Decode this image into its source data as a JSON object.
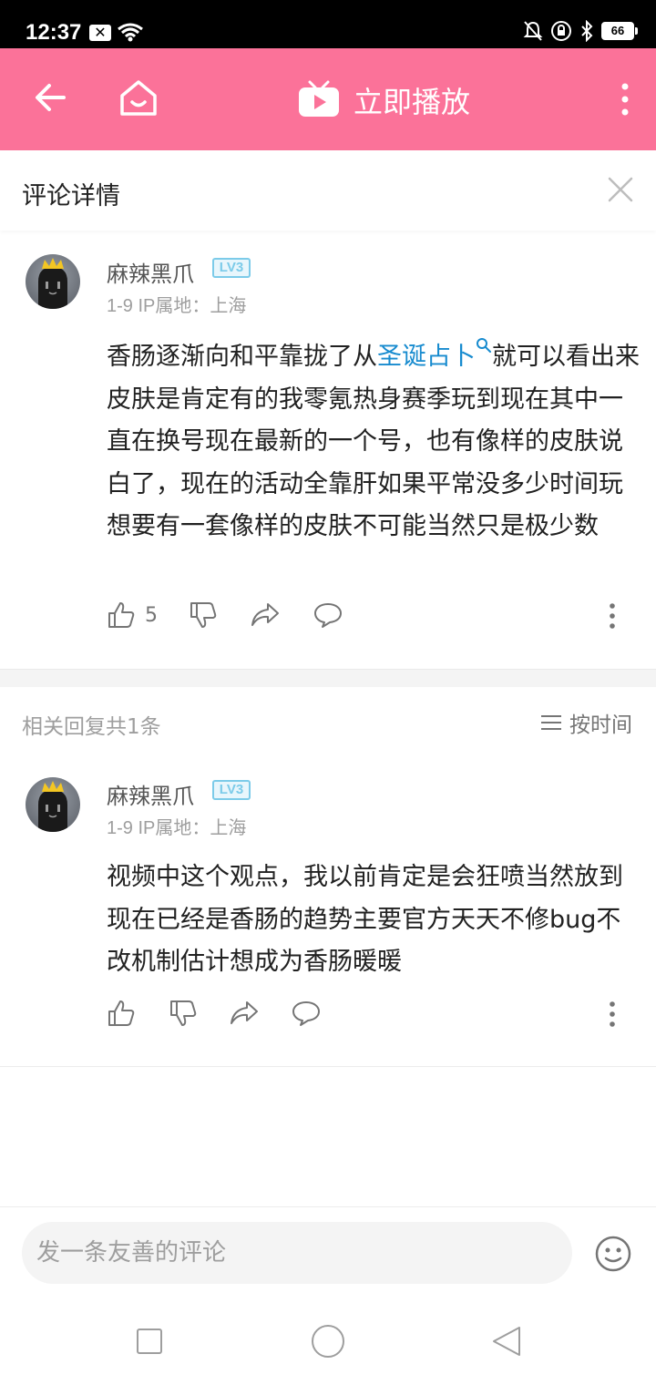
{
  "status_bar": {
    "time": "12:37",
    "battery": "66",
    "icons": [
      "notification-x-icon",
      "wifi-icon",
      "mute-bell-icon",
      "rotation-lock-icon",
      "bluetooth-icon",
      "battery-icon"
    ]
  },
  "app_bar": {
    "play_label": "立即播放",
    "icons": [
      "back-arrow-icon",
      "home-icon",
      "tv-play-icon",
      "more-vertical-icon"
    ],
    "accent_color": "#fb7299"
  },
  "detail_header": {
    "title": "评论详情"
  },
  "main_comment": {
    "username": "麻辣黑爪",
    "level": "LV3",
    "meta": "1-9  IP属地：上海",
    "text_before_link": "香肠逐渐向和平靠拢了从",
    "link_text": "圣诞占卜",
    "text_after_link": "就可以看出来皮肤是肯定有的我零氪热身赛季玩到现在其中一直在换号现在最新的一个号，也有像样的皮肤说白了，现在的活动全靠肝如果平常没多少时间玩想要有一套像样的皮肤不可能当然只是极少数",
    "likes": "5"
  },
  "replies": {
    "count_label": "相关回复共1条",
    "sort_label": "按时间"
  },
  "reply_comment": {
    "username": "麻辣黑爪",
    "level": "LV3",
    "meta": "1-9  IP属地：上海",
    "text": "视频中这个观点，我以前肯定是会狂喷当然放到现在已经是香肠的趋势主要官方天天不修bug不改机制估计想成为香肠暖暖"
  },
  "bottom_bar": {
    "input_placeholder": "发一条友善的评论"
  },
  "colors": {
    "link": "#178bcf",
    "level_badge": "#7ccbe9"
  }
}
